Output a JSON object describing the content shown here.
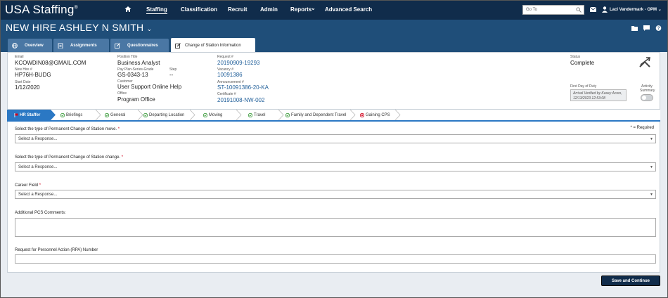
{
  "topnav": {
    "logo": "USA Staffing",
    "logo_mark": "®",
    "items": [
      "Staffing",
      "Classification",
      "Recruit",
      "Admin",
      "Reports",
      "Advanced Search"
    ],
    "reports_caret": "⌄",
    "goto_placeholder": "Go To",
    "user_name": "Laci Vandermark - OPM",
    "user_caret": "⌄"
  },
  "header": {
    "title": "NEW HIRE ASHLEY N SMITH",
    "title_caret": "⌄"
  },
  "tabs": [
    {
      "label": "Overview"
    },
    {
      "label": "Assignments"
    },
    {
      "label": "Questionnaires"
    },
    {
      "label": "Change of Station Information"
    }
  ],
  "summary": {
    "email_label": "Email",
    "email": "KCOWDIN08@GMAIL.COM",
    "new_hire_label": "New Hire #",
    "new_hire": "HP76H-BUDG",
    "start_date_label": "Start Date",
    "start_date": "1/12/2020",
    "position_title_label": "Position Title",
    "position_title": "Business Analyst",
    "pay_plan_label": "Pay Plan-Series-Grade",
    "pay_plan": "GS-0343-13",
    "step_label": "Step",
    "step": "--",
    "customer_label": "Customer",
    "customer": "User Support Online Help",
    "office_label": "Office",
    "office": "Program Office",
    "request_label": "Request #",
    "request": "20190909-19293",
    "vacancy_label": "Vacancy #",
    "vacancy": "10091386",
    "announcement_label": "Announcement #",
    "announcement": "ST-10091386-20-KA",
    "certificate_label": "Certificate #",
    "certificate": "20191008-NW-002",
    "status_label": "Status",
    "status": "Complete",
    "first_day_label": "First Day of Duty",
    "first_day_note": "Arrival Verified by Kasey Acres, 12/13/2023 12:53:08",
    "activity_label_1": "Activity",
    "activity_label_2": "Summary"
  },
  "steps": [
    {
      "label": "HR Staffer",
      "state": "active"
    },
    {
      "label": "Briefings",
      "state": "done"
    },
    {
      "label": "General",
      "state": "done"
    },
    {
      "label": "Departing Location",
      "state": "done"
    },
    {
      "label": "Moving",
      "state": "done"
    },
    {
      "label": "Travel",
      "state": "done"
    },
    {
      "label": "Family and Dependent Travel",
      "state": "done"
    },
    {
      "label": "Gaining CPS",
      "state": "error"
    }
  ],
  "form": {
    "required_note": "* = Required",
    "required_mark": "*",
    "q1_label": "Select the type of Permanent Change of Station move.",
    "q1_value": "Select a Response...",
    "q2_label": "Select the type of Permanent Change of Station change.",
    "q2_value": "Select a Response...",
    "q3_label": "Career Field",
    "q3_value": "Select a Response...",
    "q4_label": "Additional PCS Comments:",
    "q5_label": "Request for Personnel Action (RPA) Number",
    "caret": "▼"
  },
  "footer": {
    "save_label": "Save and Continue"
  },
  "colors": {
    "nav_bg": "#102c4b",
    "header_bg": "#1f4e79",
    "tab_bg": "#4a77a4",
    "step_active": "#2b78c4",
    "done_green": "#3a9a3a",
    "error_red": "#d0021b"
  }
}
